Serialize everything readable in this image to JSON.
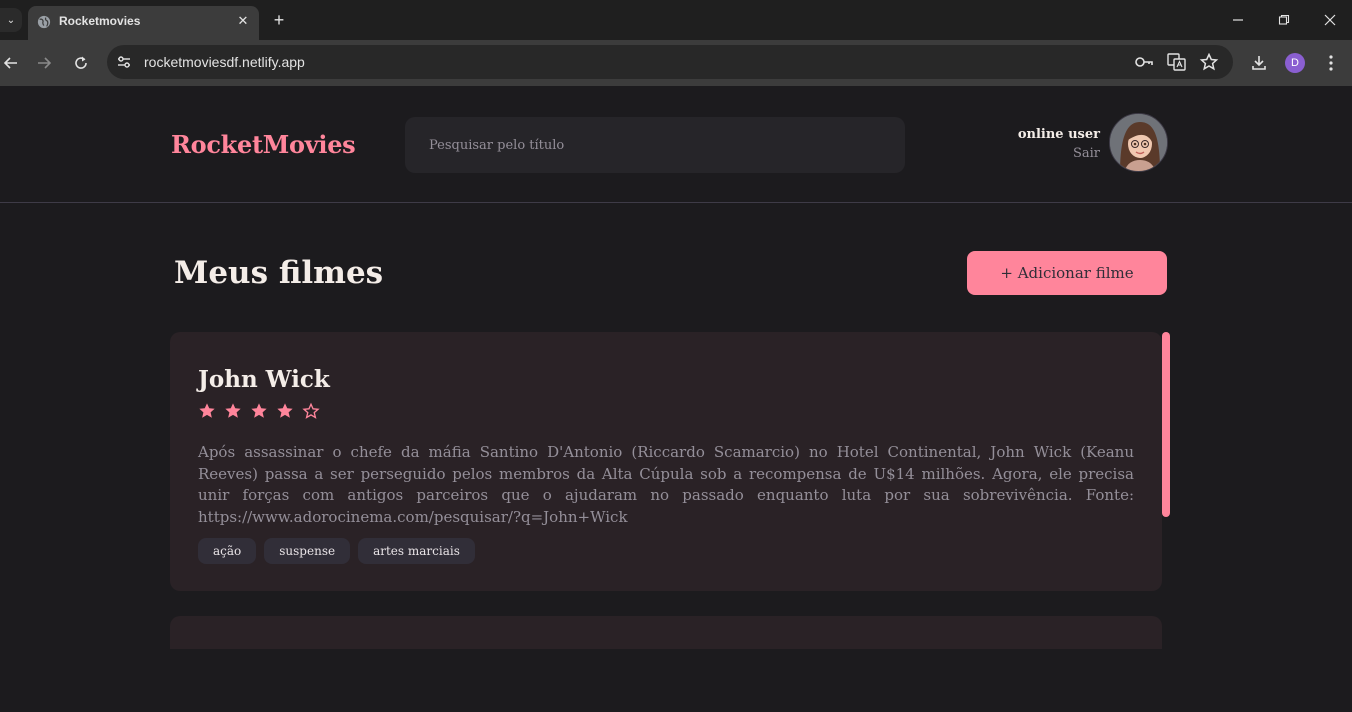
{
  "browser": {
    "tab_title": "Rocketmovies",
    "url": "rocketmoviesdf.netlify.app",
    "profile_initial": "D"
  },
  "header": {
    "brand": "RocketMovies",
    "search_placeholder": "Pesquisar pelo título",
    "user_name": "online user",
    "logout_label": "Sair"
  },
  "main": {
    "title": "Meus filmes",
    "add_button_label": "+ Adicionar filme"
  },
  "movies": [
    {
      "title": "John Wick",
      "rating": 4,
      "rating_max": 5,
      "description": "Após assassinar o chefe da máfia Santino D'Antonio (Riccardo Scamarcio) no Hotel Continental, John Wick (Keanu Reeves) passa a ser perseguido pelos membros da Alta Cúpula sob a recompensa de U$14 milhões. Agora, ele precisa unir forças com antigos parceiros que o ajudaram no passado enquanto luta por sua sobrevivência. Fonte: https://www.adorocinema.com/pesquisar/?q=John+Wick",
      "tags": [
        "ação",
        "suspense",
        "artes marciais"
      ]
    }
  ],
  "colors": {
    "accent": "#ff859b",
    "background": "#1c1b1e",
    "card": "#2a2226",
    "tag": "#312e38"
  }
}
